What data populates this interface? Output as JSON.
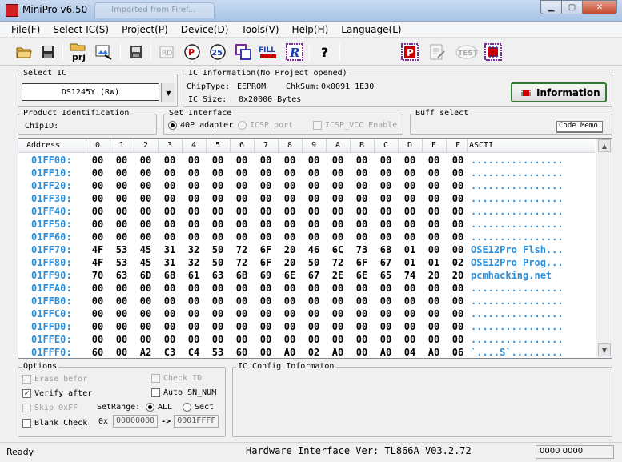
{
  "window": {
    "title": "MiniPro v6.50",
    "ghost_tab": "Imported from Firef..."
  },
  "menu": [
    "File(F)",
    "Select IC(S)",
    "Project(P)",
    "Device(D)",
    "Tools(V)",
    "Help(H)",
    "Language(L)"
  ],
  "toolbar": {
    "icons": [
      {
        "name": "open-folder-icon",
        "text": ""
      },
      {
        "name": "save-icon",
        "text": ""
      },
      {
        "name": "project-icon",
        "text": "prj"
      },
      {
        "name": "save-project-icon",
        "text": ""
      },
      {
        "name": "chip-save-icon",
        "text": ""
      },
      {
        "name": "read-chip-icon",
        "text": "RD"
      },
      {
        "name": "program-icon",
        "text": "P"
      },
      {
        "name": "verify-icon",
        "text": "25"
      },
      {
        "name": "blank-check-icon",
        "text": ""
      },
      {
        "name": "fill-icon",
        "text": "FILL"
      },
      {
        "name": "read-icon",
        "text": "R"
      },
      {
        "name": "help-icon",
        "text": "?"
      },
      {
        "name": "program-p-icon",
        "text": "P"
      },
      {
        "name": "edit-icon",
        "text": ""
      },
      {
        "name": "test-icon",
        "text": "TEST"
      },
      {
        "name": "ic-test-icon",
        "text": ""
      }
    ]
  },
  "select_ic": {
    "label": "Select IC",
    "value": "DS1245Y (RW)"
  },
  "ic_info": {
    "label": "IC Information(No Project opened)",
    "chip_type_label": "ChipType:",
    "chip_type": "EEPROM",
    "chksum_label": "ChkSum:",
    "chksum": "0x0091 1E30",
    "ic_size_label": "IC Size:",
    "ic_size": "0x20000 Bytes",
    "info_button": "Information"
  },
  "product_id": {
    "label": "Product Identification",
    "chip_id_label": "ChipID:"
  },
  "interface": {
    "label": "Set Interface",
    "opt1": "40P adapter",
    "opt2": "ICSP port",
    "opt3": "ICSP_VCC Enable"
  },
  "buff_select": {
    "label": "Buff select",
    "code_memo": "Code Memo"
  },
  "hex": {
    "header_address": "Address",
    "columns": [
      "0",
      "1",
      "2",
      "3",
      "4",
      "5",
      "6",
      "7",
      "8",
      "9",
      "A",
      "B",
      "C",
      "D",
      "E",
      "F"
    ],
    "header_ascii": "ASCII",
    "rows": [
      {
        "addr": "01FF00:",
        "bytes": [
          "00",
          "00",
          "00",
          "00",
          "00",
          "00",
          "00",
          "00",
          "00",
          "00",
          "00",
          "00",
          "00",
          "00",
          "00",
          "00"
        ],
        "ascii": "................"
      },
      {
        "addr": "01FF10:",
        "bytes": [
          "00",
          "00",
          "00",
          "00",
          "00",
          "00",
          "00",
          "00",
          "00",
          "00",
          "00",
          "00",
          "00",
          "00",
          "00",
          "00"
        ],
        "ascii": "................"
      },
      {
        "addr": "01FF20:",
        "bytes": [
          "00",
          "00",
          "00",
          "00",
          "00",
          "00",
          "00",
          "00",
          "00",
          "00",
          "00",
          "00",
          "00",
          "00",
          "00",
          "00"
        ],
        "ascii": "................"
      },
      {
        "addr": "01FF30:",
        "bytes": [
          "00",
          "00",
          "00",
          "00",
          "00",
          "00",
          "00",
          "00",
          "00",
          "00",
          "00",
          "00",
          "00",
          "00",
          "00",
          "00"
        ],
        "ascii": "................"
      },
      {
        "addr": "01FF40:",
        "bytes": [
          "00",
          "00",
          "00",
          "00",
          "00",
          "00",
          "00",
          "00",
          "00",
          "00",
          "00",
          "00",
          "00",
          "00",
          "00",
          "00"
        ],
        "ascii": "................"
      },
      {
        "addr": "01FF50:",
        "bytes": [
          "00",
          "00",
          "00",
          "00",
          "00",
          "00",
          "00",
          "00",
          "00",
          "00",
          "00",
          "00",
          "00",
          "00",
          "00",
          "00"
        ],
        "ascii": "................"
      },
      {
        "addr": "01FF60:",
        "bytes": [
          "00",
          "00",
          "00",
          "00",
          "00",
          "00",
          "00",
          "00",
          "00",
          "00",
          "00",
          "00",
          "00",
          "00",
          "00",
          "00"
        ],
        "ascii": "................"
      },
      {
        "addr": "01FF70:",
        "bytes": [
          "4F",
          "53",
          "45",
          "31",
          "32",
          "50",
          "72",
          "6F",
          "20",
          "46",
          "6C",
          "73",
          "68",
          "01",
          "00",
          "00"
        ],
        "ascii": "OSE12Pro Flsh..."
      },
      {
        "addr": "01FF80:",
        "bytes": [
          "4F",
          "53",
          "45",
          "31",
          "32",
          "50",
          "72",
          "6F",
          "20",
          "50",
          "72",
          "6F",
          "67",
          "01",
          "01",
          "02"
        ],
        "ascii": "OSE12Pro Prog..."
      },
      {
        "addr": "01FF90:",
        "bytes": [
          "70",
          "63",
          "6D",
          "68",
          "61",
          "63",
          "6B",
          "69",
          "6E",
          "67",
          "2E",
          "6E",
          "65",
          "74",
          "20",
          "20"
        ],
        "ascii": "pcmhacking.net  "
      },
      {
        "addr": "01FFA0:",
        "bytes": [
          "00",
          "00",
          "00",
          "00",
          "00",
          "00",
          "00",
          "00",
          "00",
          "00",
          "00",
          "00",
          "00",
          "00",
          "00",
          "00"
        ],
        "ascii": "................"
      },
      {
        "addr": "01FFB0:",
        "bytes": [
          "00",
          "00",
          "00",
          "00",
          "00",
          "00",
          "00",
          "00",
          "00",
          "00",
          "00",
          "00",
          "00",
          "00",
          "00",
          "00"
        ],
        "ascii": "................"
      },
      {
        "addr": "01FFC0:",
        "bytes": [
          "00",
          "00",
          "00",
          "00",
          "00",
          "00",
          "00",
          "00",
          "00",
          "00",
          "00",
          "00",
          "00",
          "00",
          "00",
          "00"
        ],
        "ascii": "................"
      },
      {
        "addr": "01FFD0:",
        "bytes": [
          "00",
          "00",
          "00",
          "00",
          "00",
          "00",
          "00",
          "00",
          "00",
          "00",
          "00",
          "00",
          "00",
          "00",
          "00",
          "00"
        ],
        "ascii": "................"
      },
      {
        "addr": "01FFE0:",
        "bytes": [
          "00",
          "00",
          "00",
          "00",
          "00",
          "00",
          "00",
          "00",
          "00",
          "00",
          "00",
          "00",
          "00",
          "00",
          "00",
          "00"
        ],
        "ascii": "................"
      },
      {
        "addr": "01FFF0:",
        "bytes": [
          "60",
          "00",
          "A2",
          "C3",
          "C4",
          "53",
          "60",
          "00",
          "A0",
          "02",
          "A0",
          "00",
          "A0",
          "04",
          "A0",
          "06"
        ],
        "ascii": "`....S`........."
      }
    ]
  },
  "options": {
    "label": "Options",
    "erase_before": "Erase befor",
    "verify_after": "Verify after",
    "skip_0xff": "Skip 0xFF",
    "blank_check": "Blank Check",
    "check_id": "Check ID",
    "auto_sn": "Auto SN_NUM",
    "setrange_label": "SetRange:",
    "all": "ALL",
    "sect": "Sect",
    "ox": "0x",
    "range_start": "00000000",
    "range_end": "0001FFFF"
  },
  "ic_config": {
    "label": "IC Config Informaton"
  },
  "status": {
    "ready": "Ready",
    "hardware": "Hardware Interface Ver: TL866A V03.2.72",
    "code": "0000 0000"
  }
}
